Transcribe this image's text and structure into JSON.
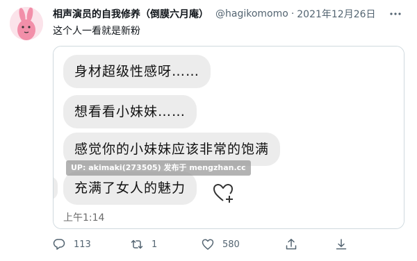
{
  "tweet": {
    "author_name": "相声演员的自我修养（倒膜六月庵）",
    "handle": "@hagikomomo",
    "separator": "·",
    "date": "2021年12月26日",
    "text": "这个人一看就是新粉"
  },
  "image": {
    "messages": [
      "身材超级性感呀……",
      "想看看小妹妹……",
      "感觉你的小妹妹应该非常的饱满",
      "充满了女人的魅力"
    ],
    "time": "上午1:14",
    "watermark": "UP: akimaki(273505) 发布于 mengzhan.cc"
  },
  "actions": {
    "reply_count": "113",
    "retweet_count": "1",
    "like_count": "580"
  },
  "colors": {
    "secondary_text": "#536471",
    "bubble_bg": "#ececec",
    "border": "#cfd9de",
    "avatar_bg": "#fbe3ea"
  },
  "icons": [
    "rabbit-avatar",
    "more-icon",
    "heart-plus-icon",
    "reply-icon",
    "retweet-icon",
    "like-icon",
    "share-icon",
    "download-icon"
  ]
}
